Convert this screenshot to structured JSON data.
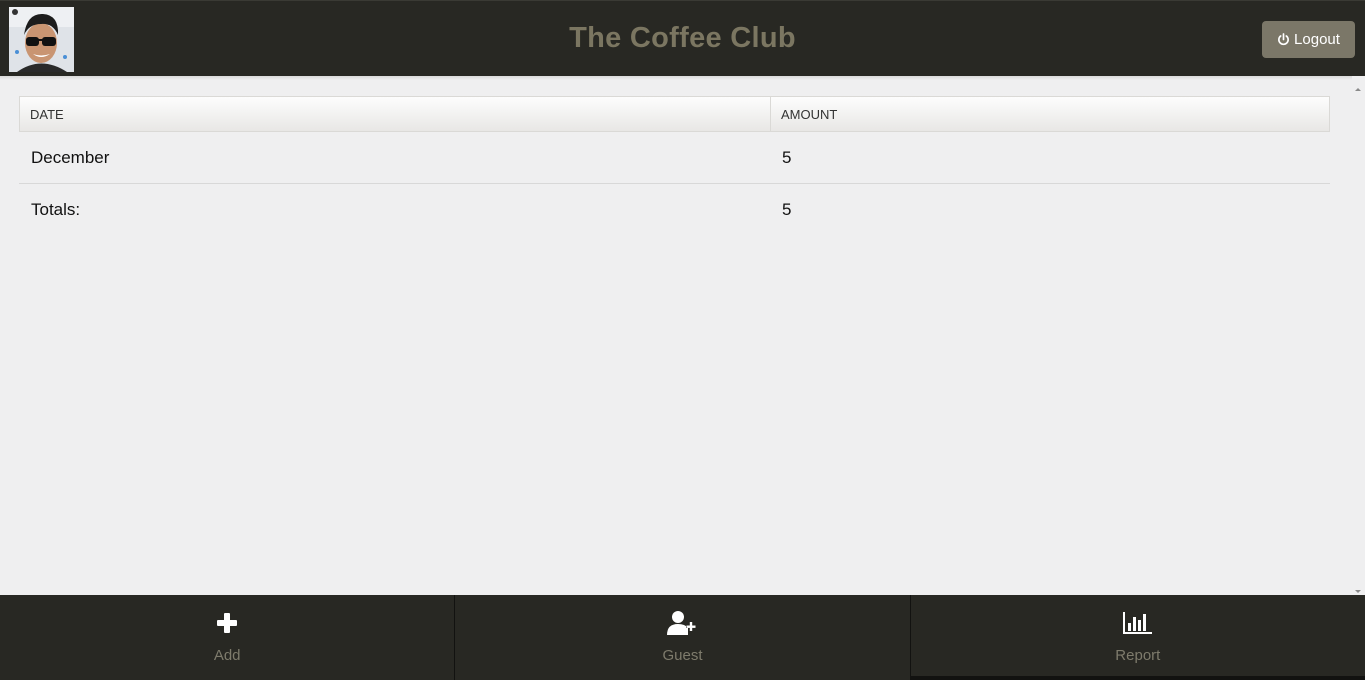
{
  "header": {
    "title": "The Coffee Club",
    "logout_label": "Logout",
    "avatar_alt": "user-avatar"
  },
  "table": {
    "columns": [
      "DATE",
      "AMOUNT"
    ],
    "rows": [
      {
        "date": "December",
        "amount": "5"
      }
    ],
    "totals": {
      "label": "Totals:",
      "amount": "5"
    }
  },
  "nav": {
    "items": [
      {
        "label": "Add",
        "icon": "plus-icon"
      },
      {
        "label": "Guest",
        "icon": "user-plus-icon"
      },
      {
        "label": "Report",
        "icon": "bar-chart-icon"
      }
    ],
    "active": "Report"
  },
  "colors": {
    "header_bg": "#282823",
    "title": "#7b7661",
    "logout_bg": "#7b7768",
    "nav_label": "#7e7b6c",
    "page_bg": "#efeff0"
  }
}
